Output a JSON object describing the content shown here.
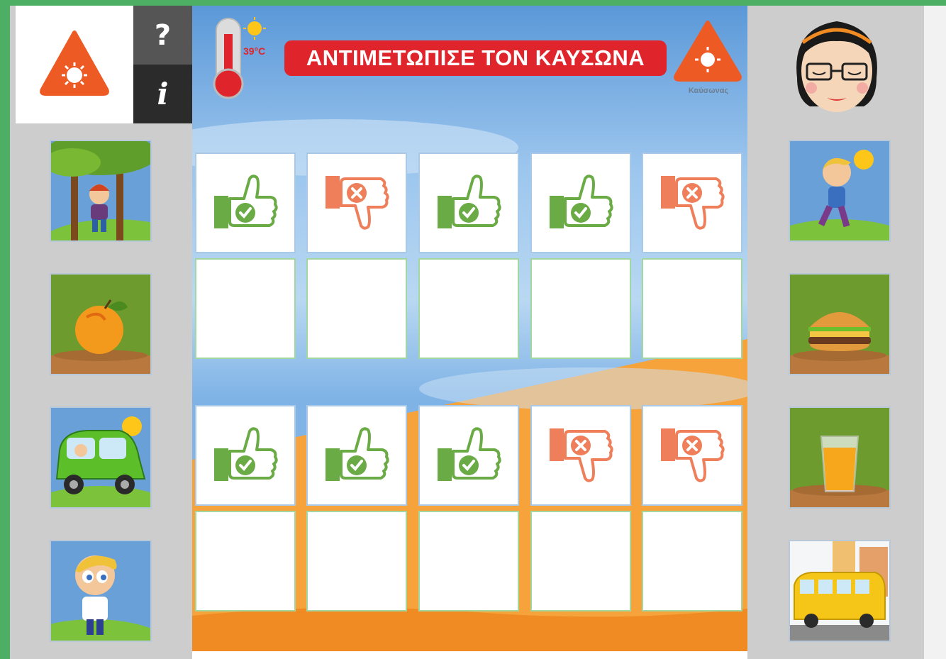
{
  "header": {
    "title": "ΑΝΤΙΜΕΤΩΠΙΣΕ ΤΟΝ ΚΑΥΣΩΝΑ",
    "temperature": "39°C",
    "heat_caption": "Καύσωνας"
  },
  "toolbar": {
    "help_label": "?",
    "info_label": "i"
  },
  "board": {
    "top_row_cards": [
      "thumbs-up",
      "thumbs-down",
      "thumbs-up",
      "thumbs-up",
      "thumbs-down"
    ],
    "bottom_row_cards": [
      "thumbs-up",
      "thumbs-up",
      "thumbs-up",
      "thumbs-down",
      "thumbs-down"
    ]
  },
  "left_tiles": [
    "boy-in-shade-under-tree",
    "peach-fruit",
    "car-in-sun",
    "boy-standing"
  ],
  "right_tiles": [
    "boy-running-in-sun",
    "hamburger",
    "orange-juice-glass",
    "school-bus"
  ],
  "colors": {
    "accent_red": "#e0242b",
    "heat_orange": "#ee5a24",
    "thumb_up_green": "#6aab46",
    "thumb_down_orange": "#ef7e5b"
  }
}
